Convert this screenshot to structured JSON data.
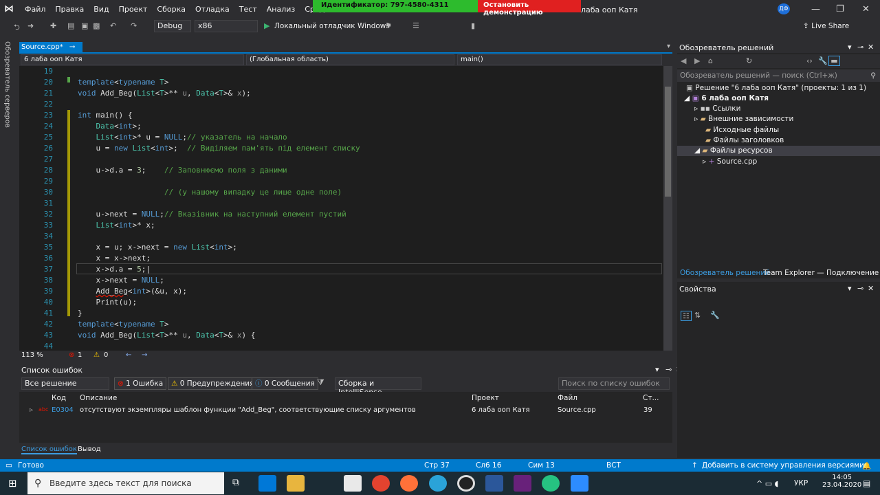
{
  "menubar": {
    "items": [
      "Файл",
      "Правка",
      "Вид",
      "Проект",
      "Сборка",
      "Отладка",
      "Тест",
      "Анализ",
      "Средства"
    ],
    "title_suffix": "лаба ооп Катя",
    "user": "ДФ"
  },
  "demo": {
    "identifier": "Идентификатор: 797-4580-4311",
    "stop": "Остановить демонстрацию"
  },
  "toolbar": {
    "config": "Debug",
    "platform": "x86",
    "debugger": "Локальный отладчик Windows",
    "live_share": "Live Share"
  },
  "left_rail": {
    "label": "Обозреватель серверов"
  },
  "tab": {
    "name": "Source.cpp*"
  },
  "navbar": {
    "project": "6 лаба ооп Катя",
    "scope": "(Глобальная область)",
    "member": "main()"
  },
  "code": {
    "lines": [
      "19",
      "20",
      "21",
      "22",
      "23",
      "24",
      "25",
      "26",
      "27",
      "28",
      "29",
      "30",
      "31",
      "32",
      "33",
      "34",
      "35",
      "36",
      "37",
      "38",
      "39",
      "40",
      "41",
      "42",
      "43",
      "44"
    ]
  },
  "editor_status": {
    "zoom": "113 %",
    "errors": "1",
    "warnings": "0"
  },
  "errlist": {
    "title": "Список ошибок",
    "scope": "Все решение",
    "errors_btn": "1 Ошибка",
    "warnings_btn": "0 Предупреждения",
    "messages_btn": "0 Сообщения",
    "source": "Сборка и IntelliSense",
    "search": "Поиск по списку ошибок",
    "columns": {
      "code": "Код",
      "desc": "Описание",
      "project": "Проект",
      "file": "Файл",
      "line": "Ст..."
    },
    "rows": [
      {
        "code": "E0304",
        "desc": "отсутствуют экземпляры шаблон функции \"Add_Beg\", соответствующие списку аргументов",
        "project": "6 лаба ооп Катя",
        "file": "Source.cpp",
        "line": "39"
      }
    ]
  },
  "bottom_tabs": {
    "errlist": "Список ошибок",
    "output": "Вывод"
  },
  "solution_explorer": {
    "title": "Обозреватель решений",
    "search": "Обозреватель решений — поиск (Ctrl+ж)",
    "solution": "Решение \"6 лаба ооп Катя\" (проекты: 1 из 1)",
    "project": "6 лаба ооп Катя",
    "nodes": [
      "Ссылки",
      "Внешние зависимости",
      "Исходные файлы",
      "Файлы заголовков",
      "Файлы ресурсов",
      "Source.cpp"
    ],
    "tab1": "Обозреватель решений",
    "tab2": "Team Explorer — Подключение"
  },
  "properties": {
    "title": "Свойства"
  },
  "statusbar": {
    "ready": "Готово",
    "line": "Стр 37",
    "col": "Сл6 16",
    "ch": "Сим 13",
    "ins": "ВСТ",
    "vcs": "Добавить в систему управления версиями"
  },
  "taskbar": {
    "search": "Введите здесь текст для поиска",
    "lang": "УКР",
    "time": "14:05",
    "date": "23.04.2020"
  }
}
